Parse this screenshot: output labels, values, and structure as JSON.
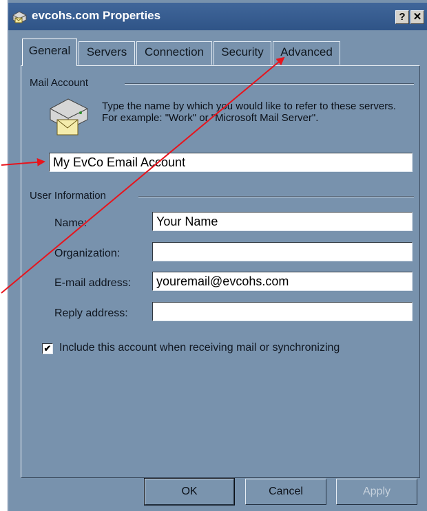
{
  "window": {
    "title": "evcohs.com Properties",
    "help_button": "?",
    "close_button": "✕"
  },
  "tabs": [
    {
      "label": "General",
      "active": true
    },
    {
      "label": "Servers",
      "active": false
    },
    {
      "label": "Connection",
      "active": false
    },
    {
      "label": "Security",
      "active": false
    },
    {
      "label": "Advanced",
      "active": false
    }
  ],
  "mail_account": {
    "group_label": "Mail Account",
    "description": "Type the name by which you would like to refer to these servers.  For example: \"Work\" or \"Microsoft Mail Server\".",
    "account_name": "My EvCo Email Account"
  },
  "user_info": {
    "group_label": "User Information",
    "fields": [
      {
        "label": "Name:",
        "value": "Your Name"
      },
      {
        "label": "Organization:",
        "value": ""
      },
      {
        "label": "E-mail address:",
        "value": "youremail@evcohs.com"
      },
      {
        "label": "Reply address:",
        "value": ""
      }
    ]
  },
  "include_checkbox": {
    "label": "Include this account when receiving mail or synchronizing",
    "checked": true,
    "mark": "✔"
  },
  "buttons": {
    "ok": "OK",
    "cancel": "Cancel",
    "apply": "Apply"
  },
  "colors": {
    "dialog_bg": "#7892ad",
    "titlebar": "#2f5487",
    "annotation_arrow": "#e8141c"
  },
  "icons": {
    "app": "mail-server-icon",
    "mail_account": "mail-server-envelope-icon"
  }
}
